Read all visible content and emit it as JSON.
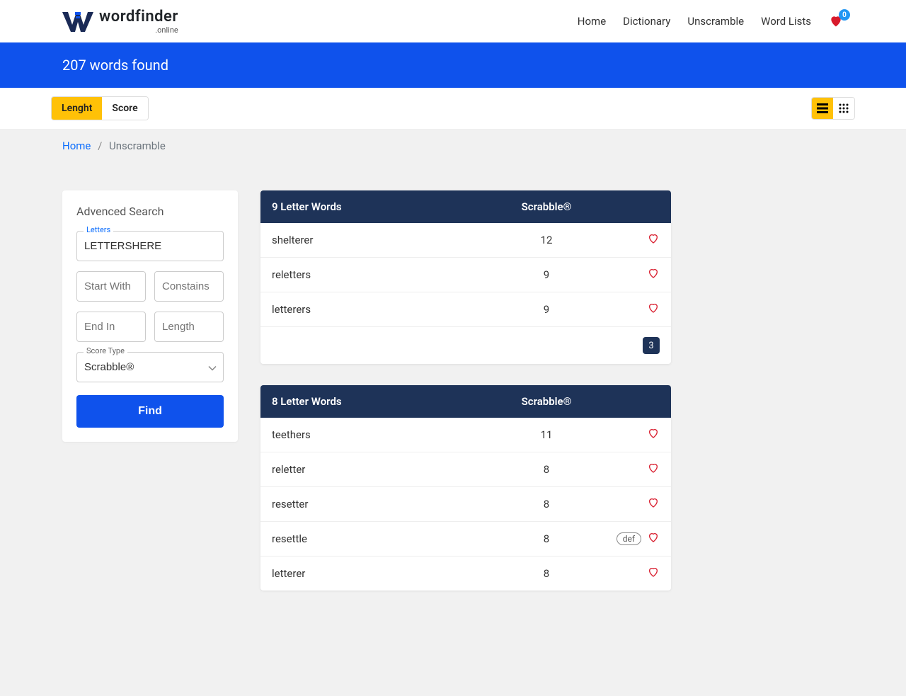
{
  "header": {
    "logo_main": "wordfinder",
    "logo_sub": ".online",
    "nav": [
      "Home",
      "Dictionary",
      "Unscramble",
      "Word Lists"
    ],
    "fav_count": "0"
  },
  "banner": {
    "text": "207 words found"
  },
  "filter": {
    "length_label": "Lenght",
    "score_label": "Score"
  },
  "breadcrumb": {
    "home": "Home",
    "current": "Unscramble"
  },
  "search": {
    "title": "Advenced Search",
    "letters_label": "Letters",
    "letters_value": "LETTERSHERE",
    "startwith_placeholder": "Start With",
    "contains_placeholder": "Constains",
    "endin_placeholder": "End In",
    "length_placeholder": "Length",
    "scoretype_label": "Score Type",
    "scoretype_value": "Scrabble®",
    "find_label": "Find"
  },
  "results": [
    {
      "title": "9 Letter Words",
      "score_col": "Scrabble®",
      "count": "3",
      "show_footer": true,
      "rows": [
        {
          "word": "shelterer",
          "score": "12",
          "def": false
        },
        {
          "word": "reletters",
          "score": "9",
          "def": false
        },
        {
          "word": "letterers",
          "score": "9",
          "def": false
        }
      ]
    },
    {
      "title": "8 Letter Words",
      "score_col": "Scrabble®",
      "count": "",
      "show_footer": false,
      "rows": [
        {
          "word": "teethers",
          "score": "11",
          "def": false
        },
        {
          "word": "reletter",
          "score": "8",
          "def": false
        },
        {
          "word": "resetter",
          "score": "8",
          "def": false
        },
        {
          "word": "resettle",
          "score": "8",
          "def": true
        },
        {
          "word": "letterer",
          "score": "8",
          "def": false
        }
      ]
    }
  ],
  "labels": {
    "def": "def"
  }
}
